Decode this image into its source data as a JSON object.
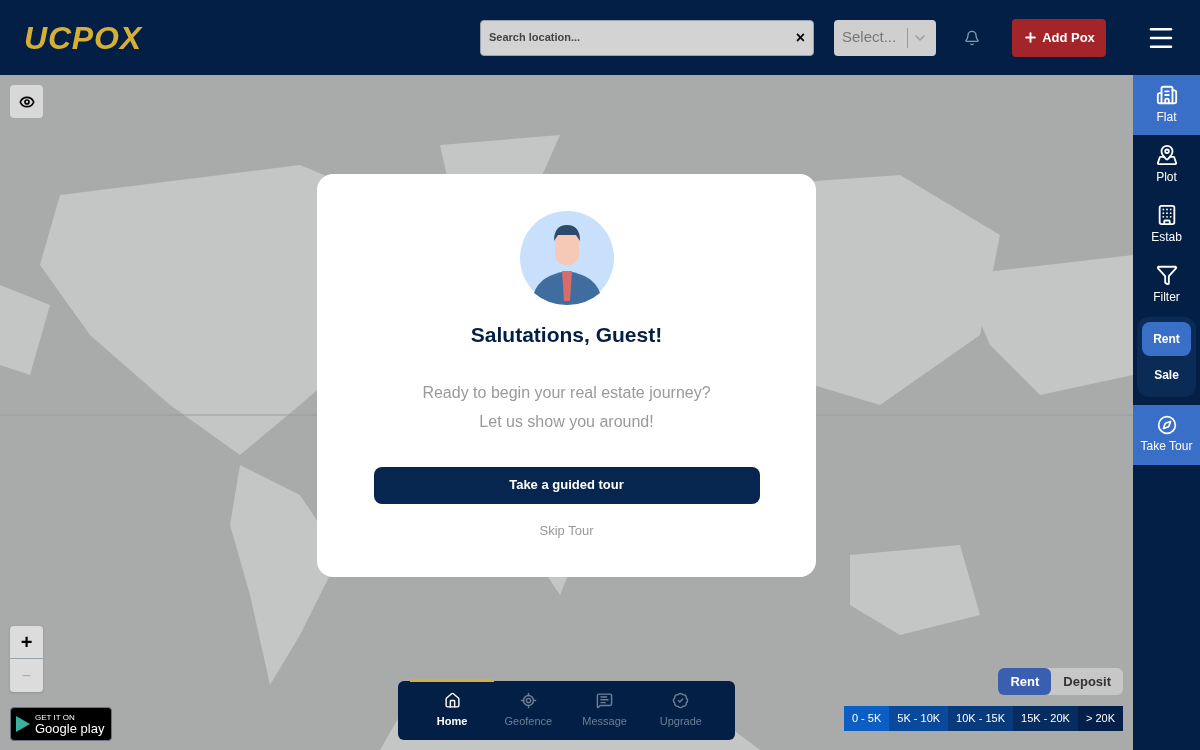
{
  "header": {
    "logo": "UCPOX",
    "search": {
      "placeholder": "Search location...",
      "clear": "×"
    },
    "select": {
      "placeholder": "Select..."
    },
    "add_button": "Add Pox"
  },
  "sidebar": {
    "items": [
      {
        "kind": "flat",
        "label": "Flat",
        "selected": true
      },
      {
        "kind": "plot",
        "label": "Plot",
        "selected": false
      },
      {
        "kind": "estab",
        "label": "Estab",
        "selected": false
      },
      {
        "kind": "filter",
        "label": "Filter",
        "selected": false
      }
    ],
    "mode": [
      {
        "label": "Rent",
        "selected": true
      },
      {
        "label": "Sale",
        "selected": false
      }
    ],
    "tour": "Take Tour"
  },
  "map": {
    "zoom_in": "+",
    "zoom_out": "−",
    "store_badge": {
      "top": "GET IT ON",
      "bottom": "Google play"
    }
  },
  "modal": {
    "title": "Salutations, Guest!",
    "message": [
      "Ready to begin your real estate journey?",
      "Let us show you around!"
    ],
    "primary": "Take a guided tour",
    "secondary": "Skip Tour"
  },
  "bottom_nav": [
    {
      "kind": "home",
      "label": "Home",
      "selected": true
    },
    {
      "kind": "geofence",
      "label": "Geofence",
      "selected": false
    },
    {
      "kind": "message",
      "label": "Message",
      "selected": false
    },
    {
      "kind": "upgrade",
      "label": "Upgrade",
      "selected": false
    }
  ],
  "price_toggle": [
    {
      "label": "Rent",
      "selected": true
    },
    {
      "label": "Deposit",
      "selected": false
    }
  ],
  "price_legend": [
    {
      "label": "0 - 5K",
      "color": "#0b5fc4"
    },
    {
      "label": "5K - 10K",
      "color": "#0a4a9c"
    },
    {
      "label": "10K - 15K",
      "color": "#083a7c"
    },
    {
      "label": "15K - 20K",
      "color": "#062c60"
    },
    {
      "label": "> 20K",
      "color": "#04204a"
    }
  ]
}
